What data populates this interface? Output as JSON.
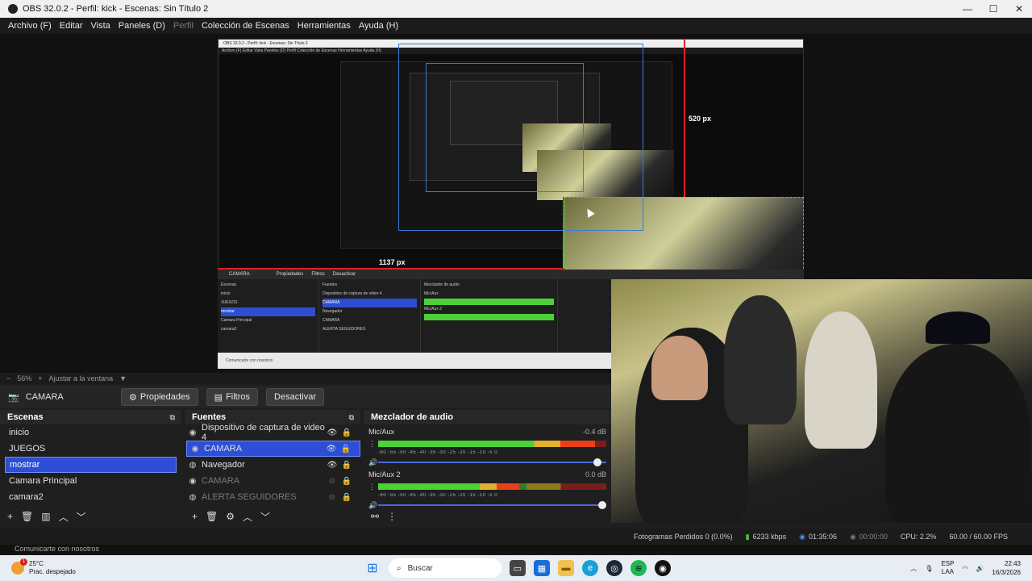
{
  "window": {
    "title": "OBS 32.0.2 - Perfil: kick - Escenas: Sin Título 2"
  },
  "menu": [
    "Archivo (F)",
    "Editar",
    "Vista",
    "Paneles (D)",
    "Perfil",
    "Colección de Escenas",
    "Herramientas",
    "Ayuda (H)"
  ],
  "preview": {
    "label_vertical": "520 px",
    "label_horizontal": "1137 px",
    "nested_title": "OBS 32.0.2 - Perfil: kick - Escenas: Sin Título 2",
    "nested_menu": "Archivo (F)   Editar   Vista   Paneles (D)   Perfil   Colección de Escenas   Herramientas   Ayuda (H)",
    "mini_source": "CAMARA",
    "mini_props": "Propiedades",
    "mini_filters": "Filtros",
    "mini_deactivate": "Desactivar",
    "mini_contact": "Comunicarte con nosotros"
  },
  "zoom": {
    "value": "56%",
    "fit_label": "Ajustar a la ventana"
  },
  "source_toolbar": {
    "source_name": "CAMARA",
    "properties_label": "Propiedades",
    "filters_label": "Filtros",
    "deactivate_label": "Desactivar"
  },
  "scenes": {
    "title": "Escenas",
    "items": [
      "inicio",
      "JUEGOS",
      "mostrar",
      "Camara Principal",
      "camara2"
    ],
    "selected_index": 2
  },
  "sources": {
    "title": "Fuentes",
    "items": [
      {
        "name": "Dispositivo de captura de video 4",
        "icon": "camera-icon",
        "visible": true
      },
      {
        "name": "CAMARA",
        "icon": "camera-icon",
        "visible": true,
        "selected": true
      },
      {
        "name": "Navegador",
        "icon": "globe-icon",
        "visible": true
      },
      {
        "name": "CAMARA",
        "icon": "camera-icon",
        "visible": false
      },
      {
        "name": "ALERTA SEGUIDORES",
        "icon": "globe-icon",
        "visible": false
      }
    ]
  },
  "mixer": {
    "title": "Mezclador de audio",
    "channels": [
      {
        "name": "Mic/Aux",
        "db": "-0.4 dB",
        "level": 0.95,
        "volume": 0.98
      },
      {
        "name": "Mic/Aux 2",
        "db": "0.0 dB",
        "level": 0.62,
        "volume": 1.0
      }
    ],
    "scale": "-60  -55  -50  -45  -40  -35  -30  -25  -20  -15  -10  -5  0"
  },
  "status": {
    "dropped_frames": "Fotogramas Perdidos 0 (0.0%)",
    "bitrate": "6233 kbps",
    "stream_time": "01:35:06",
    "record_time": "00:00:00",
    "cpu": "CPU: 2.2%",
    "fps": "60.00 / 60.00 FPS"
  },
  "contact_label": "Comunicarte con nosotros",
  "taskbar": {
    "temp": "25°C",
    "weather": "Prac. despejado",
    "weather_badge": "1",
    "search_placeholder": "Buscar",
    "lang_top": "ESP",
    "lang_bottom": "LAA",
    "time": "22:43",
    "date": "16/3/2026"
  }
}
